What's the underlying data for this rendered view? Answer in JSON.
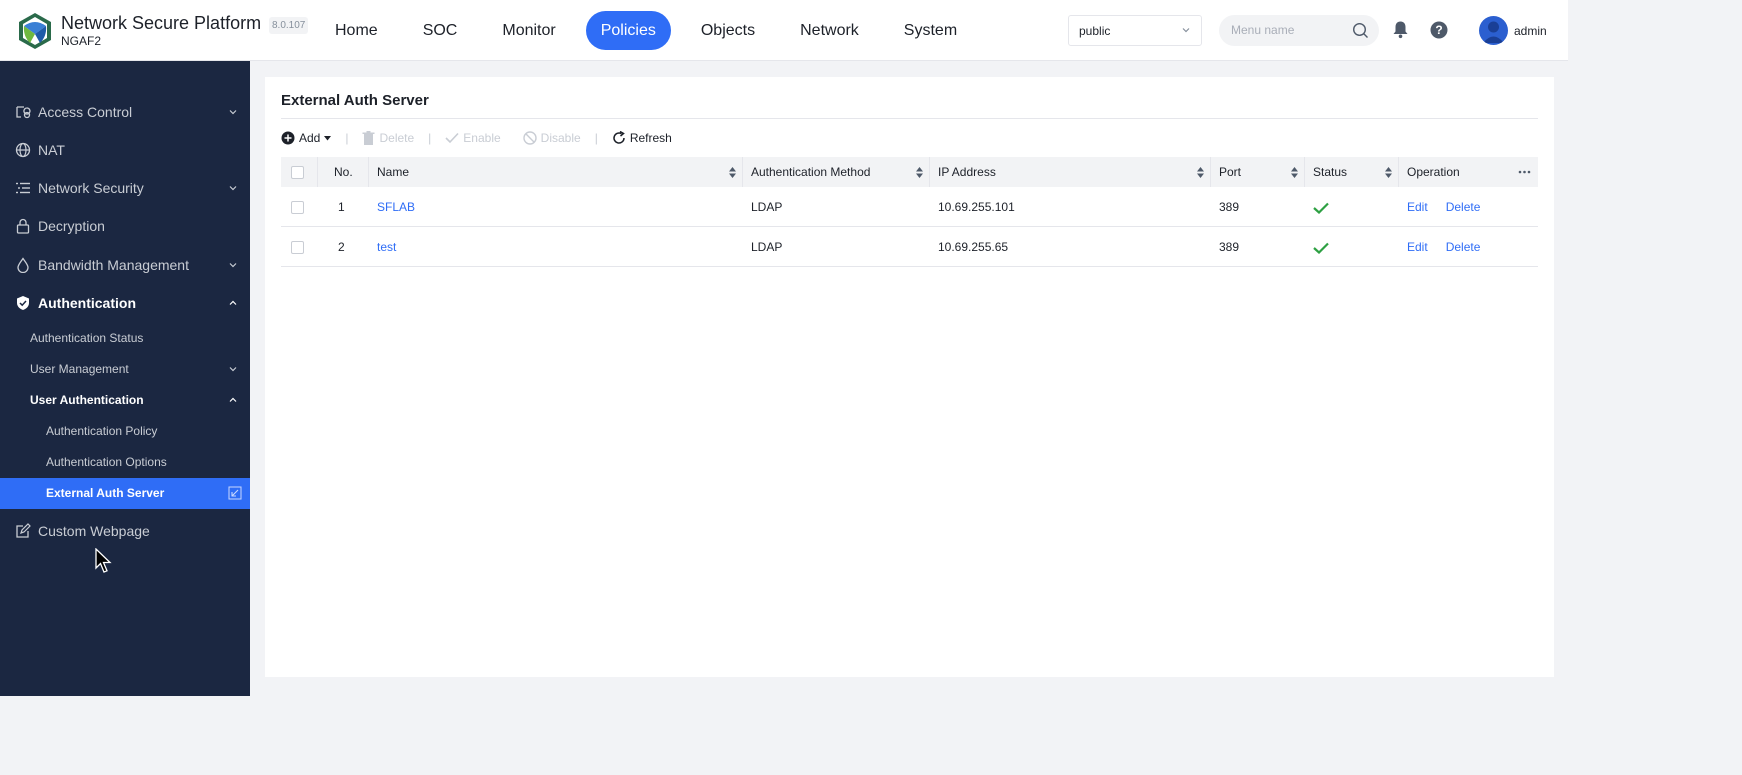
{
  "header": {
    "brand_title": "Network Secure Platform",
    "brand_subtitle": "NGAF2",
    "version": "8.0.107",
    "nav": [
      {
        "label": "Home",
        "active": false
      },
      {
        "label": "SOC",
        "active": false
      },
      {
        "label": "Monitor",
        "active": false
      },
      {
        "label": "Policies",
        "active": true
      },
      {
        "label": "Objects",
        "active": false
      },
      {
        "label": "Network",
        "active": false
      },
      {
        "label": "System",
        "active": false
      }
    ],
    "zone_select": "public",
    "search_placeholder": "Menu name",
    "user": "admin"
  },
  "sidebar": {
    "items": [
      {
        "label": "Access Control",
        "icon": "access-control-icon"
      },
      {
        "label": "NAT",
        "icon": "globe-icon"
      },
      {
        "label": "Network Security",
        "icon": "list-icon"
      },
      {
        "label": "Decryption",
        "icon": "lock-icon"
      },
      {
        "label": "Bandwidth Management",
        "icon": "drop-icon"
      },
      {
        "label": "Authentication",
        "icon": "shield-check-icon"
      },
      {
        "label": "Custom Webpage",
        "icon": "edit-icon"
      }
    ],
    "auth_children": {
      "status": "Authentication Status",
      "user_mgmt": "User Management",
      "user_auth": "User Authentication",
      "policy": "Authentication Policy",
      "options": "Authentication Options",
      "external": "External Auth Server"
    }
  },
  "main": {
    "title": "External Auth Server",
    "toolbar": {
      "add": "Add",
      "delete": "Delete",
      "enable": "Enable",
      "disable": "Disable",
      "refresh": "Refresh"
    },
    "columns": {
      "no": "No.",
      "name": "Name",
      "method": "Authentication Method",
      "ip": "IP Address",
      "port": "Port",
      "status": "Status",
      "operation": "Operation"
    },
    "rows": [
      {
        "no": "1",
        "name": "SFLAB",
        "method": "LDAP",
        "ip": "10.69.255.101",
        "port": "389",
        "status": "enabled",
        "edit": "Edit",
        "delete": "Delete"
      },
      {
        "no": "2",
        "name": "test",
        "method": "LDAP",
        "ip": "10.69.255.65",
        "port": "389",
        "status": "enabled",
        "edit": "Edit",
        "delete": "Delete"
      }
    ]
  },
  "colors": {
    "accent": "#2f6df6",
    "sidebar_bg": "#1b2741",
    "success": "#2ea043"
  }
}
